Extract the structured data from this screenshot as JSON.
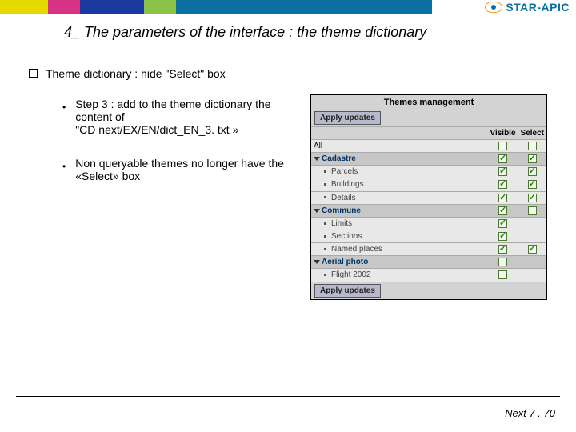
{
  "logo": {
    "text": "STAR-APIC"
  },
  "title": "4_ The parameters of the interface : the theme dictionary",
  "main_bullet": "Theme dictionary : hide \"Select\" box",
  "sub1_l1": "Step 3 : add to the theme dictionary the content of",
  "sub1_l2": "\"CD next/EX/EN/dict_EN_3. txt »",
  "sub2_l1": "Non queryable themes no longer have the «Select» box",
  "panel": {
    "title": "Themes management",
    "apply": "Apply updates",
    "col_visible": "Visible",
    "col_select": "Select",
    "row_all": "All",
    "groups": [
      {
        "name": "Cadastre",
        "visible": true,
        "select": true,
        "children": [
          {
            "name": "Parcels",
            "visible": true,
            "select": true
          },
          {
            "name": "Buildings",
            "visible": true,
            "select": true
          },
          {
            "name": "Details",
            "visible": true,
            "select": true
          }
        ]
      },
      {
        "name": "Commune",
        "visible": true,
        "select": false,
        "children": [
          {
            "name": "Limits",
            "visible": true,
            "select": null
          },
          {
            "name": "Sections",
            "visible": true,
            "select": null
          },
          {
            "name": "Named places",
            "visible": true,
            "select": true
          }
        ]
      },
      {
        "name": "Aerial photo",
        "visible": false,
        "select": null,
        "children": [
          {
            "name": "Flight 2002",
            "visible": false,
            "select": null
          }
        ]
      }
    ]
  },
  "footer": "Next 7 . 70"
}
